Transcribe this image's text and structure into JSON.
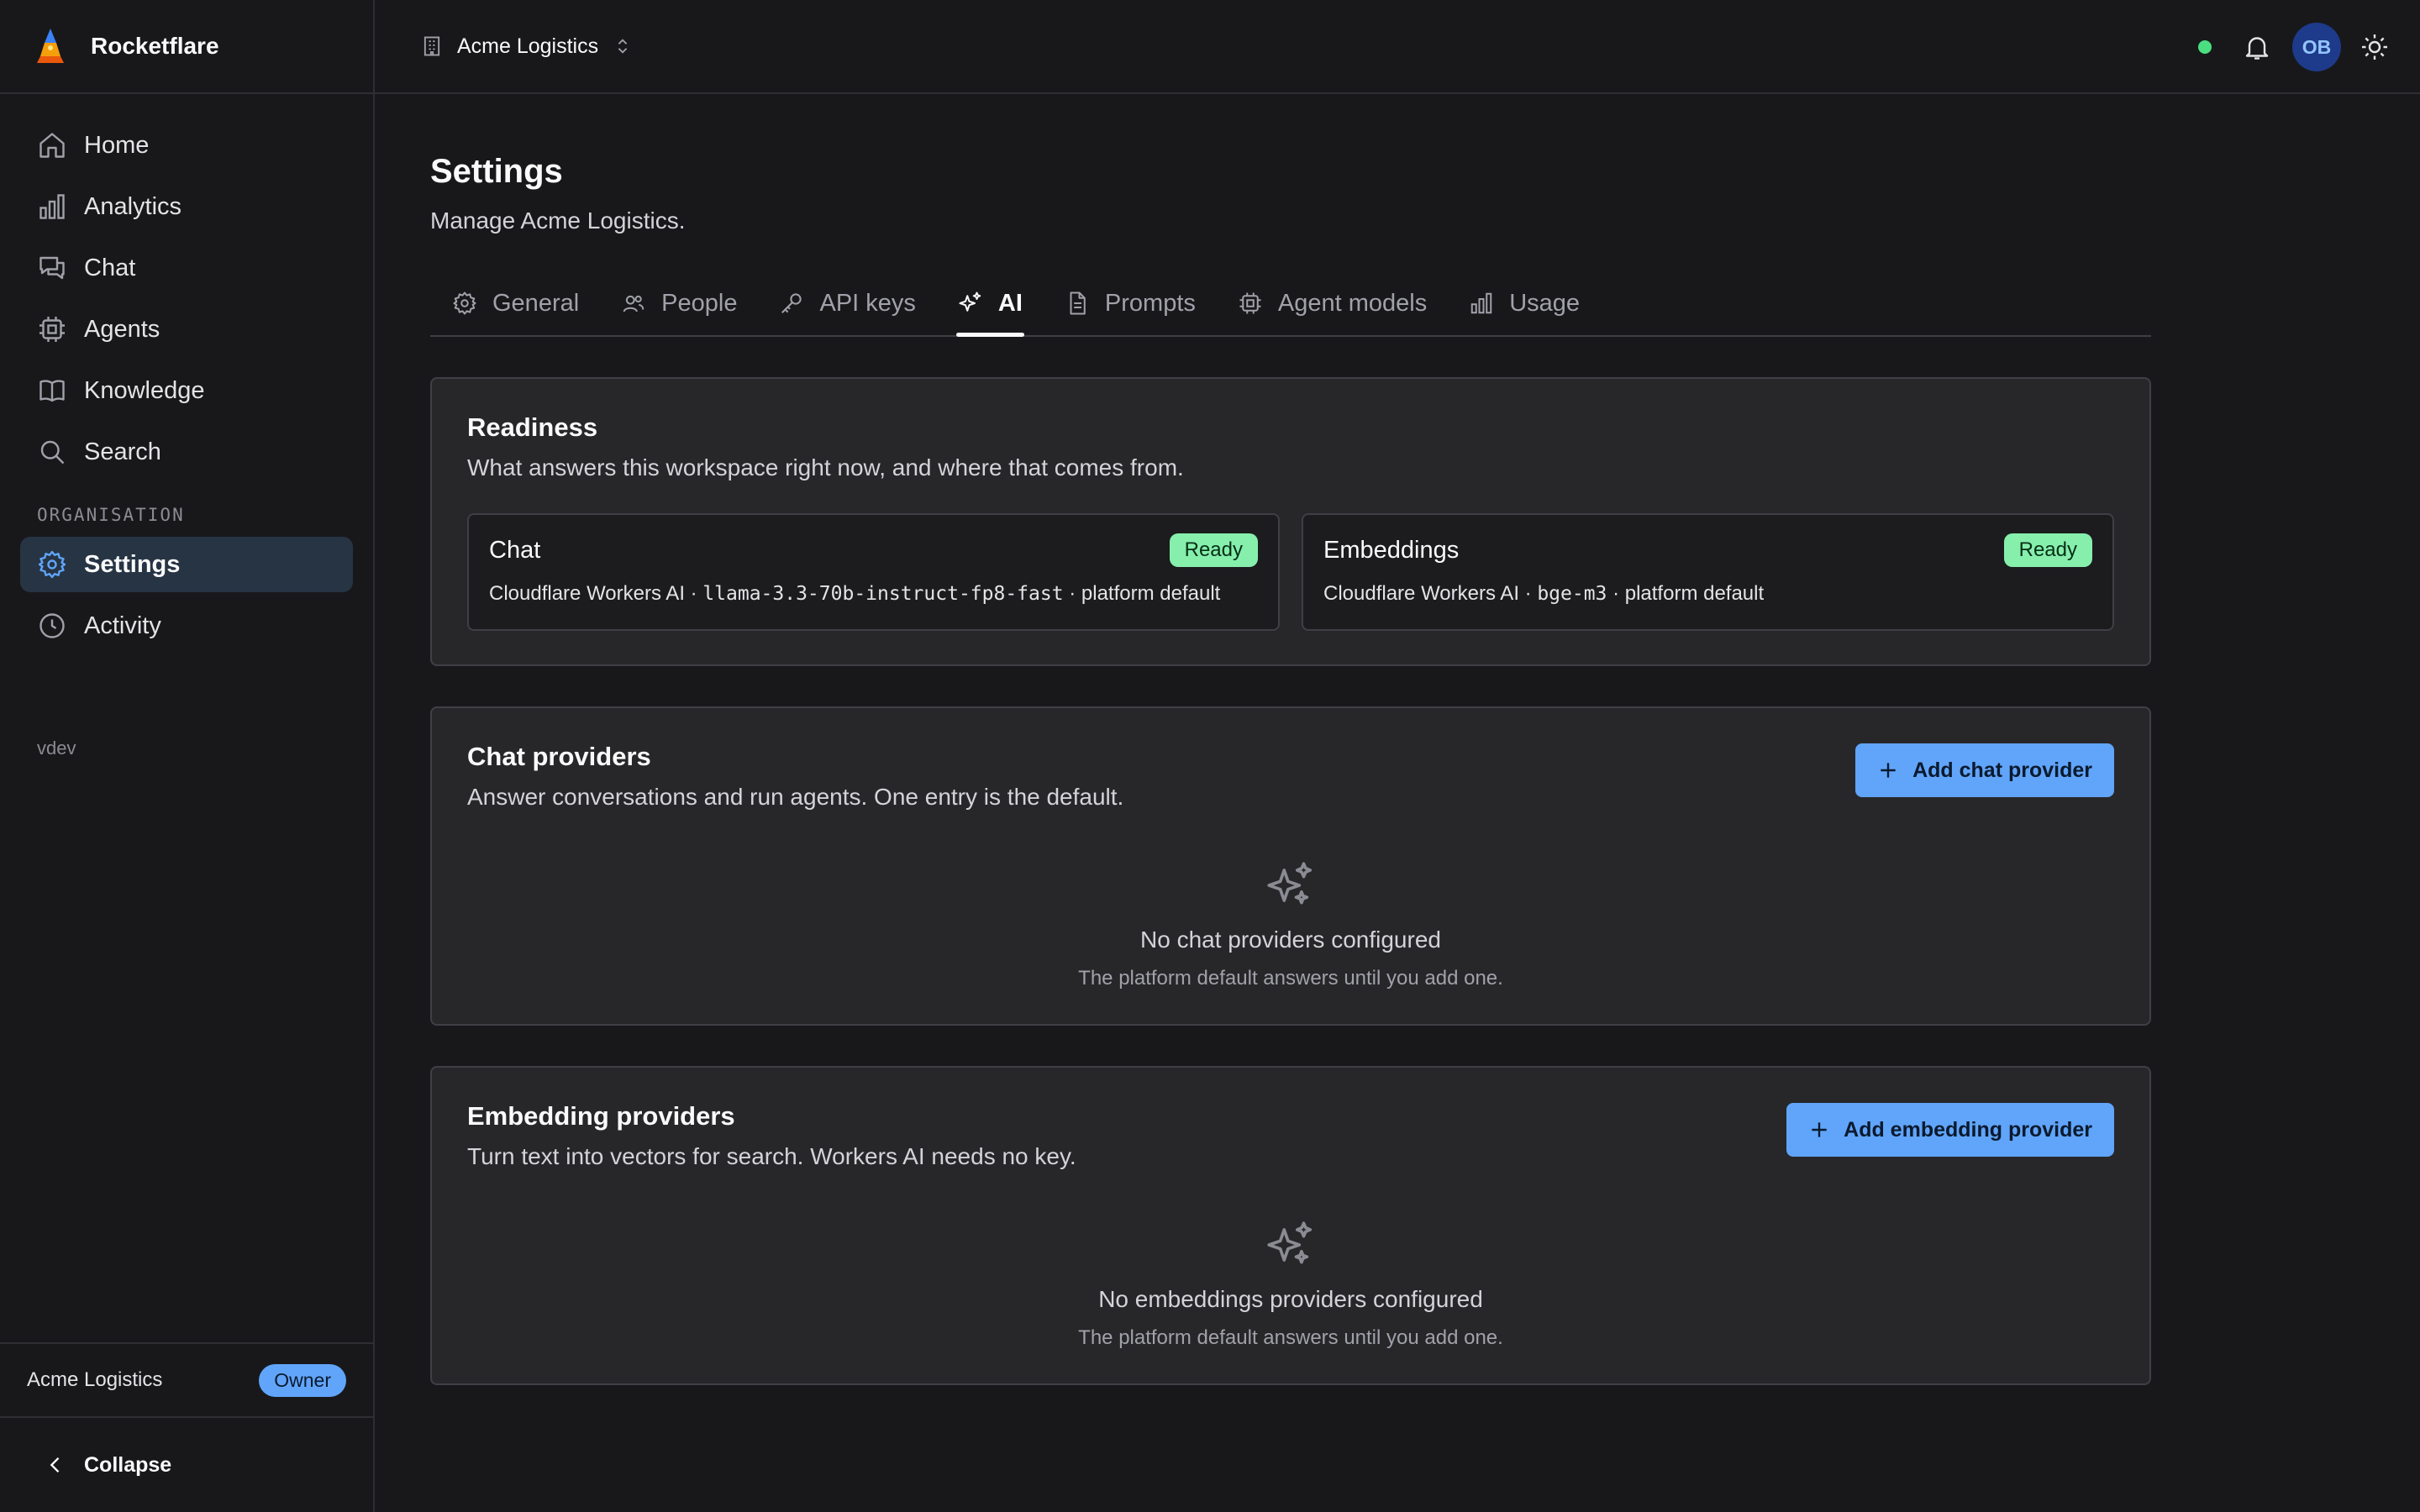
{
  "app": {
    "name": "Rocketflare"
  },
  "sidebar": {
    "items": [
      {
        "label": "Home",
        "icon": "home-icon"
      },
      {
        "label": "Analytics",
        "icon": "bar-chart-icon"
      },
      {
        "label": "Chat",
        "icon": "chat-icon"
      },
      {
        "label": "Agents",
        "icon": "cpu-icon"
      },
      {
        "label": "Knowledge",
        "icon": "book-icon"
      },
      {
        "label": "Search",
        "icon": "search-icon"
      }
    ],
    "section_label": "ORGANISATION",
    "org_items": [
      {
        "label": "Settings",
        "icon": "gear-icon",
        "active": true
      },
      {
        "label": "Activity",
        "icon": "clock-icon"
      }
    ],
    "env_label": "vdev",
    "footer": {
      "org_name": "Acme Logistics",
      "role_badge": "Owner",
      "collapse_label": "Collapse"
    }
  },
  "topbar": {
    "workspace_name": "Acme Logistics",
    "avatar_initials": "OB",
    "status_color": "#4ade80"
  },
  "page": {
    "title": "Settings",
    "subtitle": "Manage Acme Logistics."
  },
  "tabs": [
    {
      "label": "General",
      "icon": "gear-icon"
    },
    {
      "label": "People",
      "icon": "users-icon"
    },
    {
      "label": "API keys",
      "icon": "key-icon"
    },
    {
      "label": "AI",
      "icon": "sparkles-icon",
      "active": true
    },
    {
      "label": "Prompts",
      "icon": "document-icon"
    },
    {
      "label": "Agent models",
      "icon": "cpu-icon"
    },
    {
      "label": "Usage",
      "icon": "bar-chart-icon"
    }
  ],
  "readiness": {
    "title": "Readiness",
    "description": "What answers this workspace right now, and where that comes from.",
    "chat": {
      "title": "Chat",
      "badge": "Ready",
      "provider": "Cloudflare Workers AI · ",
      "model": "llama-3.3-70b-instruct-fp8-fast",
      "source": " · platform default"
    },
    "embeddings": {
      "title": "Embeddings",
      "badge": "Ready",
      "provider": "Cloudflare Workers AI · ",
      "model": "bge-m3",
      "source": " · platform default"
    }
  },
  "chat_providers": {
    "title": "Chat providers",
    "description": "Answer conversations and run agents. One entry is the default.",
    "button_label": "Add chat provider",
    "empty_title": "No chat providers configured",
    "empty_sub": "The platform default answers until you add one."
  },
  "embedding_providers": {
    "title": "Embedding providers",
    "description": "Turn text into vectors for search. Workers AI needs no key.",
    "button_label": "Add embedding provider",
    "empty_title": "No embeddings providers configured",
    "empty_sub": "The platform default answers until you add one."
  },
  "colors": {
    "accent": "#60a5fa",
    "ready": "#86efac",
    "background": "#18181b",
    "card": "#27272a"
  }
}
